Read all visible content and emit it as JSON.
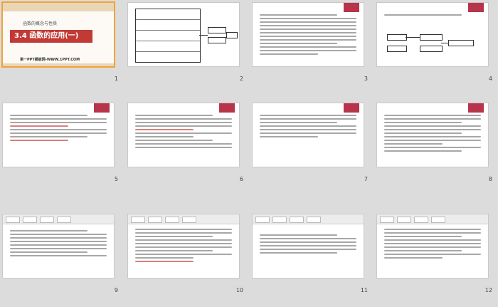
{
  "slides": [
    {
      "number": "1",
      "title_band": "3.4   函数的应用(一)",
      "subtitle": "函数的概念与性质",
      "footer": "第一PPT模板网-WWW.1PPT.COM"
    },
    {
      "number": "2"
    },
    {
      "number": "3"
    },
    {
      "number": "4"
    },
    {
      "number": "5"
    },
    {
      "number": "6"
    },
    {
      "number": "7"
    },
    {
      "number": "8"
    },
    {
      "number": "9"
    },
    {
      "number": "10"
    },
    {
      "number": "11"
    },
    {
      "number": "12"
    }
  ],
  "colors": {
    "accent_red": "#c13a35",
    "selection": "#f0a23a",
    "background": "#dcdcdc"
  }
}
